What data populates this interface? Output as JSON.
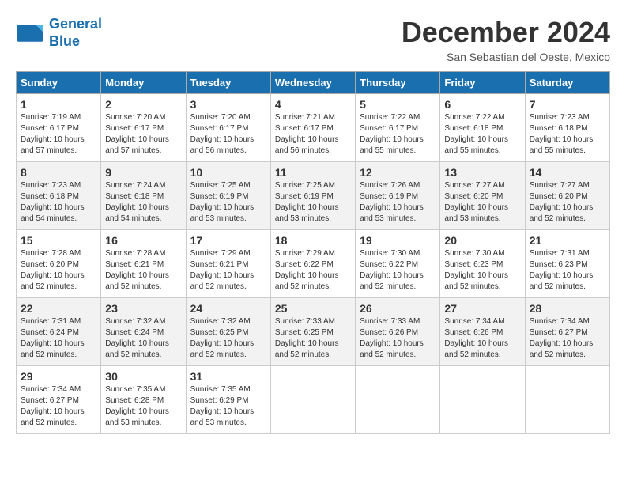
{
  "logo": {
    "line1": "General",
    "line2": "Blue"
  },
  "title": "December 2024",
  "subtitle": "San Sebastian del Oeste, Mexico",
  "days_of_week": [
    "Sunday",
    "Monday",
    "Tuesday",
    "Wednesday",
    "Thursday",
    "Friday",
    "Saturday"
  ],
  "weeks": [
    [
      {
        "day": "1",
        "info": "Sunrise: 7:19 AM\nSunset: 6:17 PM\nDaylight: 10 hours\nand 57 minutes."
      },
      {
        "day": "2",
        "info": "Sunrise: 7:20 AM\nSunset: 6:17 PM\nDaylight: 10 hours\nand 57 minutes."
      },
      {
        "day": "3",
        "info": "Sunrise: 7:20 AM\nSunset: 6:17 PM\nDaylight: 10 hours\nand 56 minutes."
      },
      {
        "day": "4",
        "info": "Sunrise: 7:21 AM\nSunset: 6:17 PM\nDaylight: 10 hours\nand 56 minutes."
      },
      {
        "day": "5",
        "info": "Sunrise: 7:22 AM\nSunset: 6:17 PM\nDaylight: 10 hours\nand 55 minutes."
      },
      {
        "day": "6",
        "info": "Sunrise: 7:22 AM\nSunset: 6:18 PM\nDaylight: 10 hours\nand 55 minutes."
      },
      {
        "day": "7",
        "info": "Sunrise: 7:23 AM\nSunset: 6:18 PM\nDaylight: 10 hours\nand 55 minutes."
      }
    ],
    [
      {
        "day": "8",
        "info": "Sunrise: 7:23 AM\nSunset: 6:18 PM\nDaylight: 10 hours\nand 54 minutes."
      },
      {
        "day": "9",
        "info": "Sunrise: 7:24 AM\nSunset: 6:18 PM\nDaylight: 10 hours\nand 54 minutes."
      },
      {
        "day": "10",
        "info": "Sunrise: 7:25 AM\nSunset: 6:19 PM\nDaylight: 10 hours\nand 53 minutes."
      },
      {
        "day": "11",
        "info": "Sunrise: 7:25 AM\nSunset: 6:19 PM\nDaylight: 10 hours\nand 53 minutes."
      },
      {
        "day": "12",
        "info": "Sunrise: 7:26 AM\nSunset: 6:19 PM\nDaylight: 10 hours\nand 53 minutes."
      },
      {
        "day": "13",
        "info": "Sunrise: 7:27 AM\nSunset: 6:20 PM\nDaylight: 10 hours\nand 53 minutes."
      },
      {
        "day": "14",
        "info": "Sunrise: 7:27 AM\nSunset: 6:20 PM\nDaylight: 10 hours\nand 52 minutes."
      }
    ],
    [
      {
        "day": "15",
        "info": "Sunrise: 7:28 AM\nSunset: 6:20 PM\nDaylight: 10 hours\nand 52 minutes."
      },
      {
        "day": "16",
        "info": "Sunrise: 7:28 AM\nSunset: 6:21 PM\nDaylight: 10 hours\nand 52 minutes."
      },
      {
        "day": "17",
        "info": "Sunrise: 7:29 AM\nSunset: 6:21 PM\nDaylight: 10 hours\nand 52 minutes."
      },
      {
        "day": "18",
        "info": "Sunrise: 7:29 AM\nSunset: 6:22 PM\nDaylight: 10 hours\nand 52 minutes."
      },
      {
        "day": "19",
        "info": "Sunrise: 7:30 AM\nSunset: 6:22 PM\nDaylight: 10 hours\nand 52 minutes."
      },
      {
        "day": "20",
        "info": "Sunrise: 7:30 AM\nSunset: 6:23 PM\nDaylight: 10 hours\nand 52 minutes."
      },
      {
        "day": "21",
        "info": "Sunrise: 7:31 AM\nSunset: 6:23 PM\nDaylight: 10 hours\nand 52 minutes."
      }
    ],
    [
      {
        "day": "22",
        "info": "Sunrise: 7:31 AM\nSunset: 6:24 PM\nDaylight: 10 hours\nand 52 minutes."
      },
      {
        "day": "23",
        "info": "Sunrise: 7:32 AM\nSunset: 6:24 PM\nDaylight: 10 hours\nand 52 minutes."
      },
      {
        "day": "24",
        "info": "Sunrise: 7:32 AM\nSunset: 6:25 PM\nDaylight: 10 hours\nand 52 minutes."
      },
      {
        "day": "25",
        "info": "Sunrise: 7:33 AM\nSunset: 6:25 PM\nDaylight: 10 hours\nand 52 minutes."
      },
      {
        "day": "26",
        "info": "Sunrise: 7:33 AM\nSunset: 6:26 PM\nDaylight: 10 hours\nand 52 minutes."
      },
      {
        "day": "27",
        "info": "Sunrise: 7:34 AM\nSunset: 6:26 PM\nDaylight: 10 hours\nand 52 minutes."
      },
      {
        "day": "28",
        "info": "Sunrise: 7:34 AM\nSunset: 6:27 PM\nDaylight: 10 hours\nand 52 minutes."
      }
    ],
    [
      {
        "day": "29",
        "info": "Sunrise: 7:34 AM\nSunset: 6:27 PM\nDaylight: 10 hours\nand 52 minutes."
      },
      {
        "day": "30",
        "info": "Sunrise: 7:35 AM\nSunset: 6:28 PM\nDaylight: 10 hours\nand 53 minutes."
      },
      {
        "day": "31",
        "info": "Sunrise: 7:35 AM\nSunset: 6:29 PM\nDaylight: 10 hours\nand 53 minutes."
      },
      null,
      null,
      null,
      null
    ]
  ]
}
